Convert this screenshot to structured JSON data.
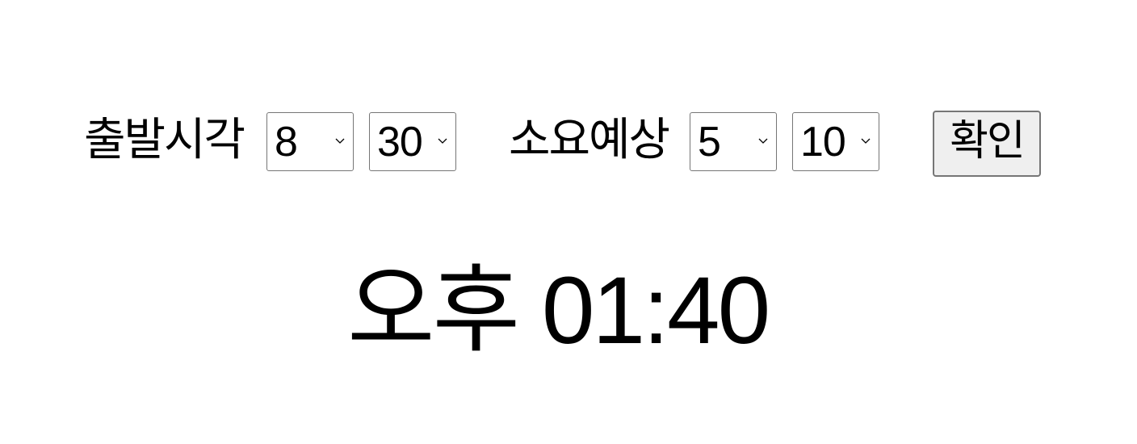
{
  "form": {
    "departure_label": "출발시각",
    "departure_hour": "8",
    "departure_minute": "30",
    "duration_label": "소요예상",
    "duration_hours": "5",
    "duration_minutes": "10",
    "confirm_label": "확인"
  },
  "result": {
    "text": "오후 01:40"
  }
}
